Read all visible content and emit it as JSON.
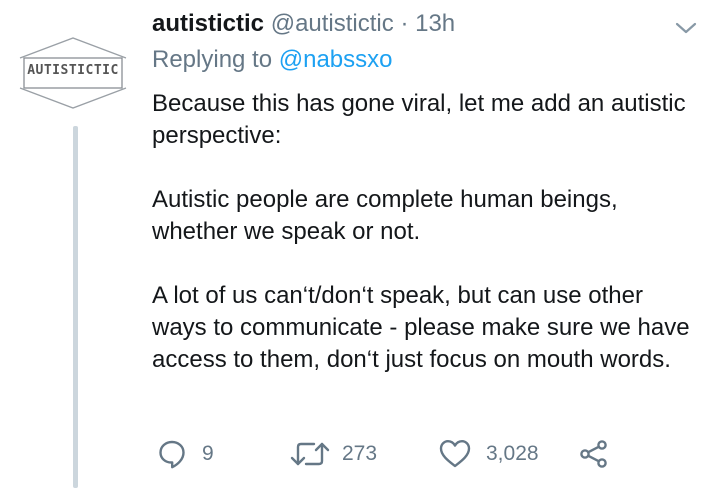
{
  "avatar": {
    "text": "AUTISTICTIC"
  },
  "tweet": {
    "display_name": "autistictic",
    "handle": "@autistictic",
    "separator": "·",
    "time": "13h",
    "replying_prefix": "Replying to",
    "replying_handle": "@nabssxo",
    "paragraphs": [
      "Because this has gone viral, let me add an autistic perspective:",
      "Autistic people are complete human beings, whether we speak or not.",
      "A lot of us can‘t/don‘t speak, but can use other ways to communicate - please make sure we have access to them, don‘t just focus on mouth words."
    ]
  },
  "actions": {
    "reply_count": "9",
    "retweet_count": "273",
    "like_count": "3,028"
  },
  "icons": {
    "menu": "chevron-down-icon",
    "reply": "reply-icon",
    "retweet": "retweet-icon",
    "like": "heart-icon",
    "share": "share-icon"
  },
  "colors": {
    "link": "#1da1f2",
    "secondary_text": "#657786",
    "thread_line": "#ccd6dd"
  }
}
